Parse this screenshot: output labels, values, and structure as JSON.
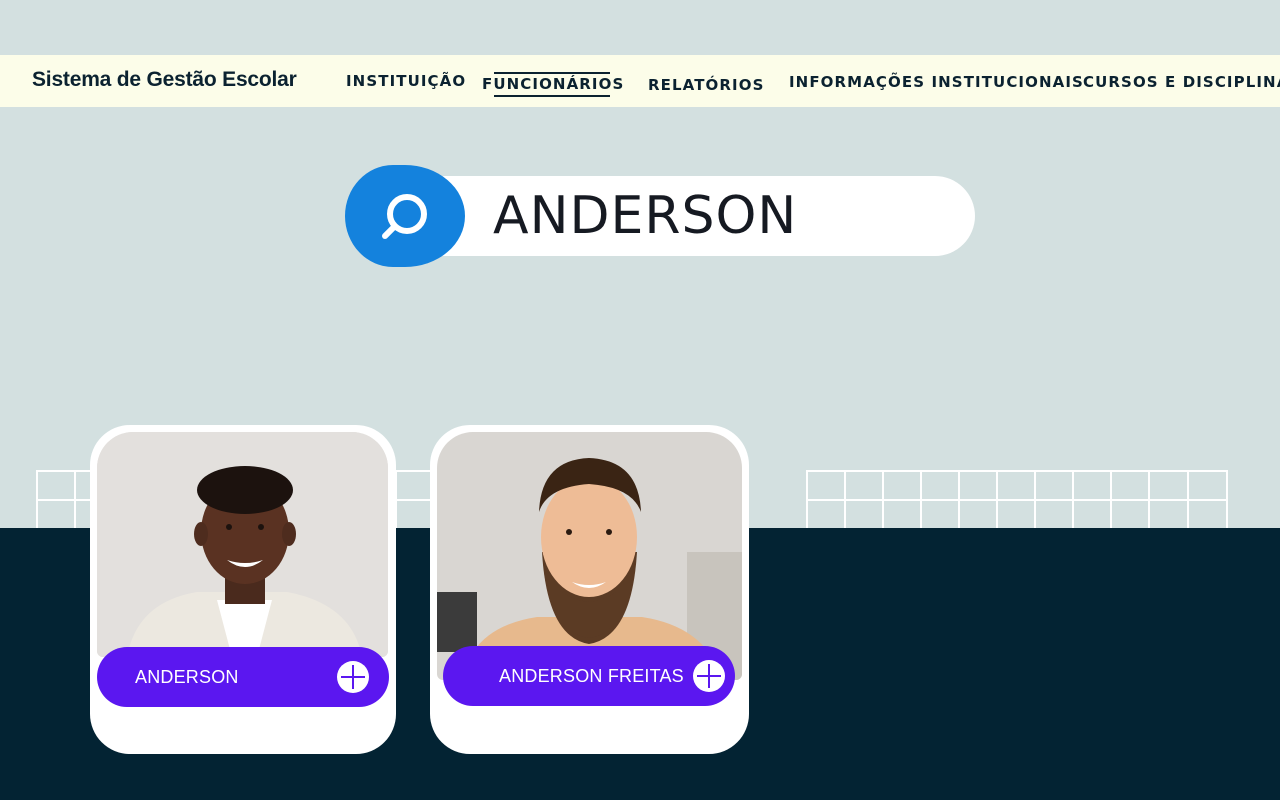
{
  "header": {
    "app_title": "Sistema de Gestão Escolar",
    "nav": [
      {
        "label": "INSTITUIÇÃO",
        "active": false
      },
      {
        "label": "FUNCIONÁRIOS",
        "active": true
      },
      {
        "label": "RELATÓRIOS",
        "active": false
      },
      {
        "label": "INFORMAÇÕES INSTITUCIONAIS",
        "active": false
      },
      {
        "label": "CURSOS E DISCIPLINAS",
        "active": false
      }
    ]
  },
  "search": {
    "value": "ANDERSON",
    "icon": "search-icon"
  },
  "results": [
    {
      "name": "ANDERSON",
      "action_icon": "plus-icon"
    },
    {
      "name": "ANDERSON FREITAS",
      "action_icon": "plus-icon"
    }
  ],
  "colors": {
    "background": "#d3e0e0",
    "navbar": "#fcfde9",
    "dark_band": "#032333",
    "search_button": "#1482dd",
    "name_pill": "#5b17f0",
    "text_dark": "#0b2230"
  }
}
